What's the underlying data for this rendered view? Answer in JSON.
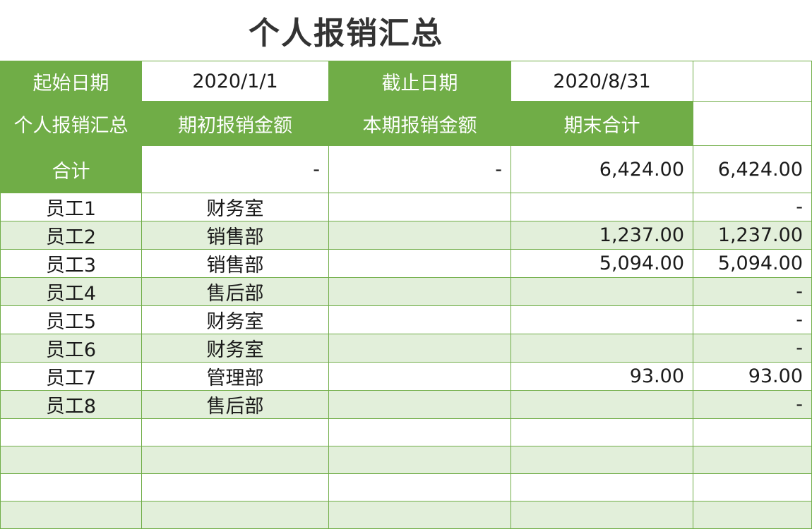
{
  "title": "个人报销汇总",
  "date_row": {
    "start_label": "起始日期",
    "start_value": "2020/1/1",
    "end_label": "截止日期",
    "end_value": "2020/8/31"
  },
  "header": {
    "col1": "个人报销汇总",
    "col2": "期初报销金额",
    "col3": "本期报销金额",
    "col4": "期末合计"
  },
  "total_row": {
    "label": "合计",
    "opening": "-",
    "current": "-",
    "col4": "6,424.00",
    "col5": "6,424.00"
  },
  "rows": [
    {
      "name": "员工1",
      "dept": "财务室",
      "c3": "",
      "c4": "",
      "c5": "-"
    },
    {
      "name": "员工2",
      "dept": "销售部",
      "c3": "",
      "c4": "1,237.00",
      "c5": "1,237.00"
    },
    {
      "name": "员工3",
      "dept": "销售部",
      "c3": "",
      "c4": "5,094.00",
      "c5": "5,094.00"
    },
    {
      "name": "员工4",
      "dept": "售后部",
      "c3": "",
      "c4": "",
      "c5": "-"
    },
    {
      "name": "员工5",
      "dept": "财务室",
      "c3": "",
      "c4": "",
      "c5": "-"
    },
    {
      "name": "员工6",
      "dept": "财务室",
      "c3": "",
      "c4": "",
      "c5": "-"
    },
    {
      "name": "员工7",
      "dept": "管理部",
      "c3": "",
      "c4": "93.00",
      "c5": "93.00"
    },
    {
      "name": "员工8",
      "dept": "售后部",
      "c3": "",
      "c4": "",
      "c5": "-"
    },
    {
      "name": "",
      "dept": "",
      "c3": "",
      "c4": "",
      "c5": ""
    },
    {
      "name": "",
      "dept": "",
      "c3": "",
      "c4": "",
      "c5": ""
    },
    {
      "name": "",
      "dept": "",
      "c3": "",
      "c4": "",
      "c5": ""
    },
    {
      "name": "",
      "dept": "",
      "c3": "",
      "c4": "",
      "c5": ""
    }
  ],
  "colors": {
    "header_green": "#70ad47",
    "stripe_green": "#e2efda",
    "title_gray": "#333333"
  }
}
